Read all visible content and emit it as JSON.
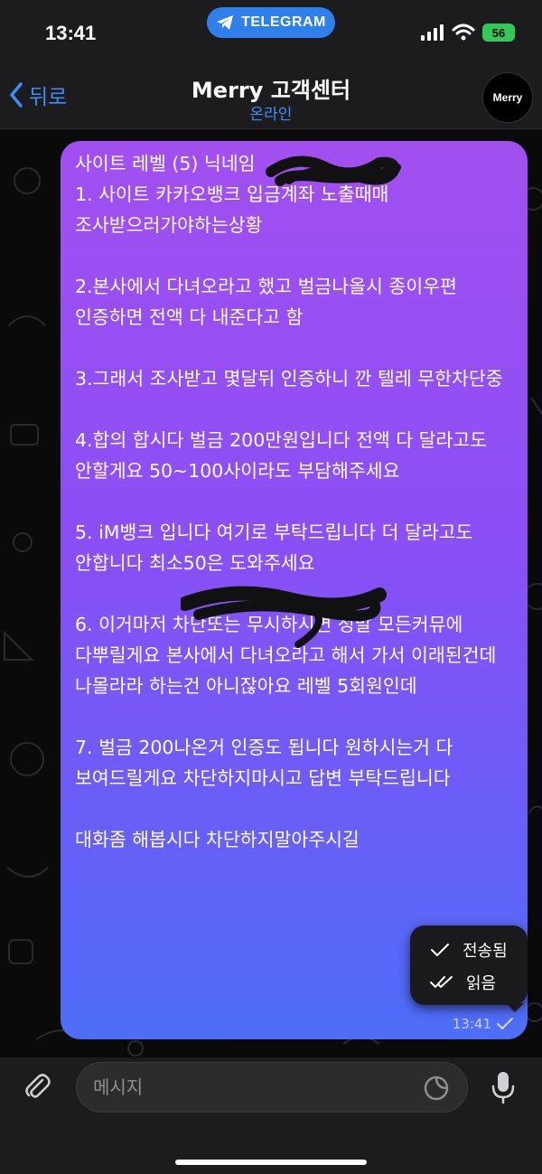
{
  "status_bar": {
    "time": "13:41",
    "app_pill": "TELEGRAM",
    "battery": "56"
  },
  "header": {
    "back_label": "뒤로",
    "title": "Merry 고객센터",
    "subtitle": "온라인",
    "avatar_text": "Merry"
  },
  "message": {
    "paragraphs": [
      "사이트 레벨 (5) 닉네임 \n1. 사이트 카카오뱅크 입금계좌 노출때매 조사받으러가야하는상황",
      "2.본사에서 다녀오라고 했고 벌금나올시 종이우편 인증하면 전액 다 내준다고 함",
      "3.그래서 조사받고 몇달뒤 인증하니 깐 텔레 무한차단중",
      "4.합의 합시다 벌금 200만원입니다 전액 다 달라고도 안할게요 50~100사이라도 부담해주세요",
      "5. iM뱅크 입니다 여기로 부탁드립니다 더 달라고도 안합니다 최소50은 도와주세요",
      "6. 이거마저 차단또는 무시하시면 정말 모든커뮤에 다뿌릴게요 본사에서 다녀오라고 해서 가서 이래된건데 나몰라라 하는건 아니잖아요 레벨 5회원인데",
      "7. 벌금 200나온거 인증도 됩니다 원하시는거 다 보여드릴게요 차단하지마시고 답변 부탁드립니다",
      "대화좀 해봅시다 차단하지말아주시길"
    ],
    "time": "13:41"
  },
  "status_popup": {
    "sent_label": "전송됨",
    "read_label": "읽음"
  },
  "input": {
    "placeholder": "메시지"
  },
  "colors": {
    "accent": "#3e8ef7",
    "bubble_top": "#a24ff0",
    "bubble_bottom": "#4d6ef8",
    "battery": "#34c759"
  }
}
